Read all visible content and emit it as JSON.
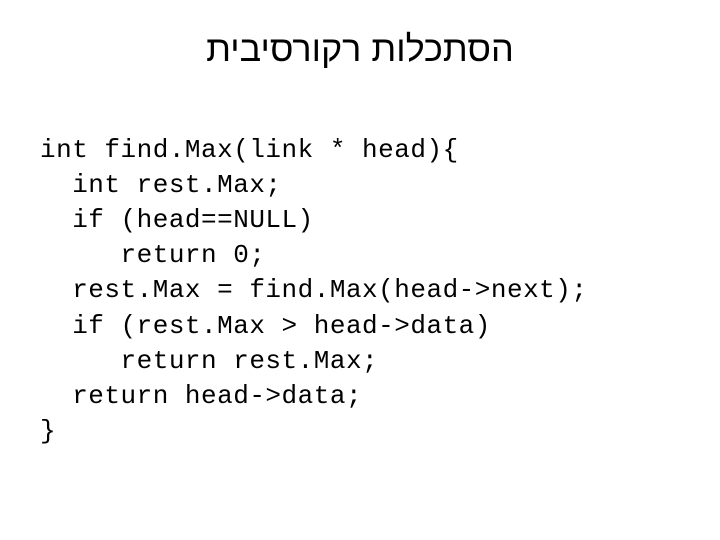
{
  "title": "הסתכלות רקורסיבית",
  "code": {
    "l1": "int find.Max(link * head){",
    "l2": "  int rest.Max;",
    "l3": "  if (head==NULL)",
    "l4": "     return 0;",
    "l5": "  rest.Max = find.Max(head->next);",
    "l6": "  if (rest.Max > head->data)",
    "l7": "     return rest.Max;",
    "l8": "  return head->data;",
    "l9": "}"
  }
}
